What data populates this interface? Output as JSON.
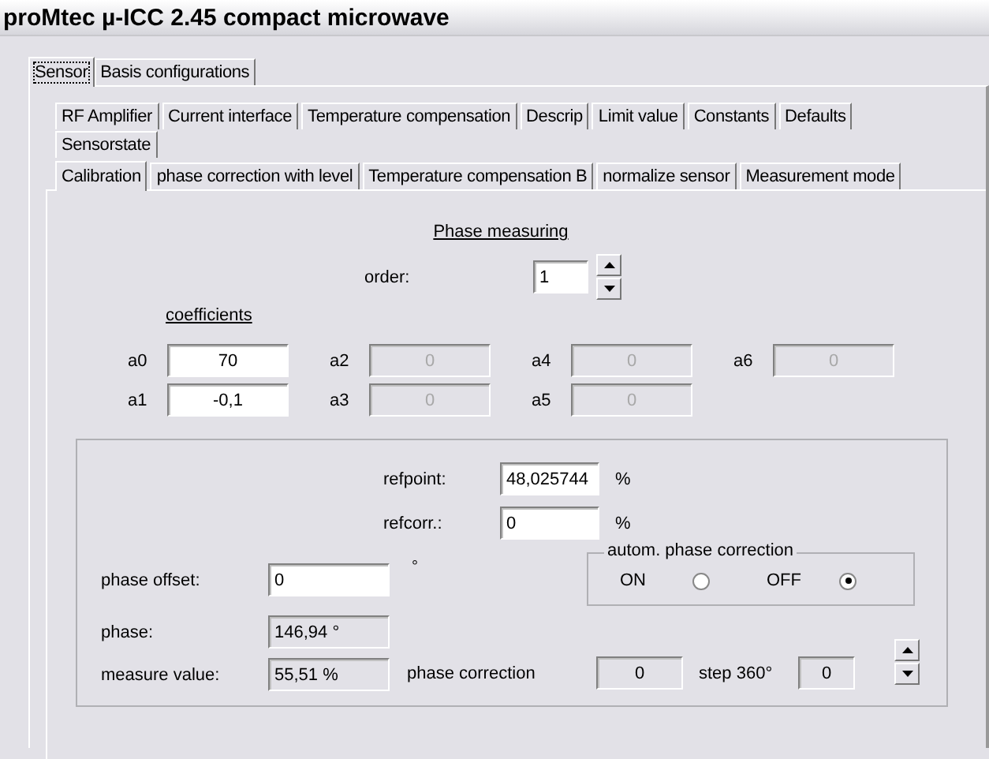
{
  "window": {
    "title": "proMtec µ-ICC 2.45 compact microwave"
  },
  "tabs": [
    {
      "label": "Sensor",
      "selected": true
    },
    {
      "label": "Basis configurations",
      "selected": false
    }
  ],
  "subtab_rows": [
    {
      "tabs": [
        {
          "label": "RF Amplifier",
          "selected": false
        },
        {
          "label": "Current interface",
          "selected": false
        },
        {
          "label": "Temperature compensation",
          "selected": false
        },
        {
          "label": "Descrip",
          "selected": false
        },
        {
          "label": "Limit value",
          "selected": false
        },
        {
          "label": "Constants",
          "selected": false
        },
        {
          "label": "Defaults",
          "selected": false
        }
      ]
    },
    {
      "tabs": [
        {
          "label": "Sensorstate",
          "selected": false
        }
      ]
    },
    {
      "tabs": [
        {
          "label": "Calibration",
          "selected": true
        },
        {
          "label": "phase correction with level",
          "selected": false
        },
        {
          "label": "Temperature compensation B",
          "selected": false
        },
        {
          "label": "normalize sensor",
          "selected": false
        },
        {
          "label": "Measurement mode",
          "selected": false
        }
      ]
    }
  ],
  "phase_measuring": {
    "heading": "Phase measuring",
    "order_label": "order:",
    "order_value": "1"
  },
  "coefficients": {
    "heading": "coefficients",
    "rows": [
      [
        {
          "label": "a0",
          "value": "70",
          "disabled": false
        },
        {
          "label": "a2",
          "value": "0",
          "disabled": true
        },
        {
          "label": "a4",
          "value": "0",
          "disabled": true
        },
        {
          "label": "a6",
          "value": "0",
          "disabled": true
        }
      ],
      [
        {
          "label": "a1",
          "value": "-0,1",
          "disabled": false
        },
        {
          "label": "a3",
          "value": "0",
          "disabled": true
        },
        {
          "label": "a5",
          "value": "0",
          "disabled": true
        }
      ]
    ]
  },
  "reference": {
    "refpoint_label": "refpoint:",
    "refpoint_value": "48,025744",
    "refpoint_unit": "%",
    "refcorr_label": "refcorr.:",
    "refcorr_value": "0",
    "refcorr_unit": "%"
  },
  "phase_offset": {
    "label": "phase offset:",
    "value": "0",
    "unit": "°"
  },
  "auto_correction": {
    "title": "autom. phase correction",
    "options": [
      {
        "label": "ON",
        "selected": false
      },
      {
        "label": "OFF",
        "selected": true
      }
    ]
  },
  "phase": {
    "label": "phase:",
    "value": "146,94 °"
  },
  "measure_value": {
    "label": "measure value:",
    "value": "55,51 %"
  },
  "phase_correction": {
    "label": "phase correction",
    "value": "0",
    "step_label": "step 360°",
    "step_value": "0"
  }
}
